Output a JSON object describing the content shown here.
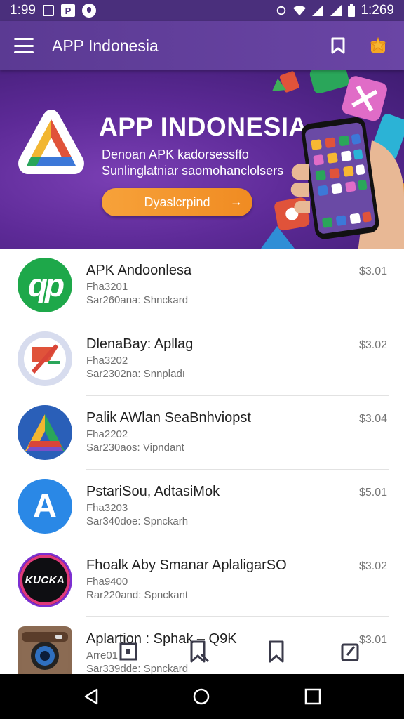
{
  "status_bar": {
    "time_left": "1:99",
    "time_right": "1:269",
    "p_badge": "P"
  },
  "app_bar": {
    "title": "APP Indonesia",
    "icons": [
      "menu-icon",
      "bookmark-icon",
      "star-badge-icon"
    ]
  },
  "banner": {
    "title": "APP INDONESIA",
    "subtitle_line1": "Denoan APK kadorsessffo",
    "subtitle_line2": "Sunlinglatniar saomohanclolsers",
    "cta_label": "Dyaslcrpind",
    "cta_arrow": "→"
  },
  "apps": [
    {
      "name": "APK Andoonlesa",
      "line1": "Fha3201",
      "line2": "Sar260ana: Shnckard",
      "price": "$3.01",
      "icon_text": "qp",
      "icon": "qp-logo-icon"
    },
    {
      "name": "DlenaBay: Apllag",
      "line1": "Fha3202",
      "line2": "Sar2302na: Snnpladı",
      "price": "$3.02",
      "icon_text": "",
      "icon": "crossed-d-logo-icon"
    },
    {
      "name": "Palik AWlan SeaBnhviopst",
      "line1": "Fha2202",
      "line2": "Sar230aos: Vipndant",
      "price": "$3.04",
      "icon_text": "A",
      "icon": "triangle-a-logo-icon"
    },
    {
      "name": "PstariSou, AdtasiMok",
      "line1": "Fha3203",
      "line2": "Sar340doe: Spnckarh",
      "price": "$5.01",
      "icon_text": "A",
      "icon": "blue-a-logo-icon"
    },
    {
      "name": "Fhoalk Aby Smanar AplaligarSO",
      "line1": "Fha9400",
      "line2": "Rar220and: Spnckant",
      "price": "$3.02",
      "icon_text": "KUCKA",
      "icon": "kucka-logo-icon"
    },
    {
      "name": "Aplartion : Sphak – Q9K",
      "line1": "Arre01",
      "line2": "Sar339dde: Spnckard",
      "price": "$3.01",
      "icon_text": "",
      "icon": "camera-icon"
    }
  ],
  "bottom_tabs": [
    "square-tab-icon",
    "bookmark-x-tab-icon",
    "bookmark-tab-icon",
    "clipboard-tab-icon"
  ],
  "nav": [
    "back-icon",
    "home-icon",
    "recents-icon"
  ]
}
